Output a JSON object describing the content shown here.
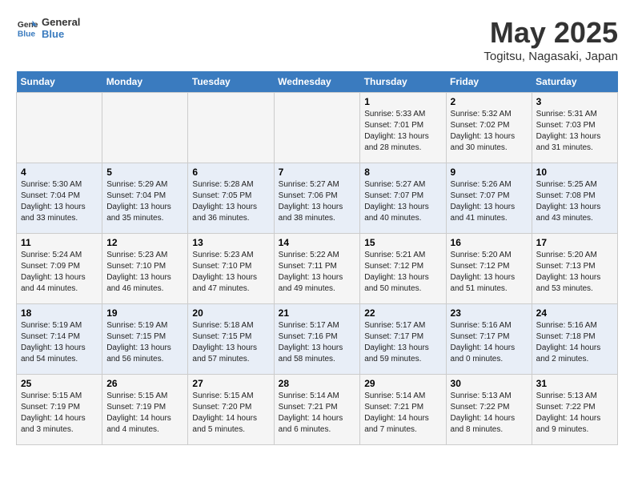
{
  "logo": {
    "line1": "General",
    "line2": "Blue"
  },
  "title": "May 2025",
  "subtitle": "Togitsu, Nagasaki, Japan",
  "days_of_week": [
    "Sunday",
    "Monday",
    "Tuesday",
    "Wednesday",
    "Thursday",
    "Friday",
    "Saturday"
  ],
  "weeks": [
    [
      {
        "day": "",
        "detail": ""
      },
      {
        "day": "",
        "detail": ""
      },
      {
        "day": "",
        "detail": ""
      },
      {
        "day": "",
        "detail": ""
      },
      {
        "day": "1",
        "detail": "Sunrise: 5:33 AM\nSunset: 7:01 PM\nDaylight: 13 hours\nand 28 minutes."
      },
      {
        "day": "2",
        "detail": "Sunrise: 5:32 AM\nSunset: 7:02 PM\nDaylight: 13 hours\nand 30 minutes."
      },
      {
        "day": "3",
        "detail": "Sunrise: 5:31 AM\nSunset: 7:03 PM\nDaylight: 13 hours\nand 31 minutes."
      }
    ],
    [
      {
        "day": "4",
        "detail": "Sunrise: 5:30 AM\nSunset: 7:04 PM\nDaylight: 13 hours\nand 33 minutes."
      },
      {
        "day": "5",
        "detail": "Sunrise: 5:29 AM\nSunset: 7:04 PM\nDaylight: 13 hours\nand 35 minutes."
      },
      {
        "day": "6",
        "detail": "Sunrise: 5:28 AM\nSunset: 7:05 PM\nDaylight: 13 hours\nand 36 minutes."
      },
      {
        "day": "7",
        "detail": "Sunrise: 5:27 AM\nSunset: 7:06 PM\nDaylight: 13 hours\nand 38 minutes."
      },
      {
        "day": "8",
        "detail": "Sunrise: 5:27 AM\nSunset: 7:07 PM\nDaylight: 13 hours\nand 40 minutes."
      },
      {
        "day": "9",
        "detail": "Sunrise: 5:26 AM\nSunset: 7:07 PM\nDaylight: 13 hours\nand 41 minutes."
      },
      {
        "day": "10",
        "detail": "Sunrise: 5:25 AM\nSunset: 7:08 PM\nDaylight: 13 hours\nand 43 minutes."
      }
    ],
    [
      {
        "day": "11",
        "detail": "Sunrise: 5:24 AM\nSunset: 7:09 PM\nDaylight: 13 hours\nand 44 minutes."
      },
      {
        "day": "12",
        "detail": "Sunrise: 5:23 AM\nSunset: 7:10 PM\nDaylight: 13 hours\nand 46 minutes."
      },
      {
        "day": "13",
        "detail": "Sunrise: 5:23 AM\nSunset: 7:10 PM\nDaylight: 13 hours\nand 47 minutes."
      },
      {
        "day": "14",
        "detail": "Sunrise: 5:22 AM\nSunset: 7:11 PM\nDaylight: 13 hours\nand 49 minutes."
      },
      {
        "day": "15",
        "detail": "Sunrise: 5:21 AM\nSunset: 7:12 PM\nDaylight: 13 hours\nand 50 minutes."
      },
      {
        "day": "16",
        "detail": "Sunrise: 5:20 AM\nSunset: 7:12 PM\nDaylight: 13 hours\nand 51 minutes."
      },
      {
        "day": "17",
        "detail": "Sunrise: 5:20 AM\nSunset: 7:13 PM\nDaylight: 13 hours\nand 53 minutes."
      }
    ],
    [
      {
        "day": "18",
        "detail": "Sunrise: 5:19 AM\nSunset: 7:14 PM\nDaylight: 13 hours\nand 54 minutes."
      },
      {
        "day": "19",
        "detail": "Sunrise: 5:19 AM\nSunset: 7:15 PM\nDaylight: 13 hours\nand 56 minutes."
      },
      {
        "day": "20",
        "detail": "Sunrise: 5:18 AM\nSunset: 7:15 PM\nDaylight: 13 hours\nand 57 minutes."
      },
      {
        "day": "21",
        "detail": "Sunrise: 5:17 AM\nSunset: 7:16 PM\nDaylight: 13 hours\nand 58 minutes."
      },
      {
        "day": "22",
        "detail": "Sunrise: 5:17 AM\nSunset: 7:17 PM\nDaylight: 13 hours\nand 59 minutes."
      },
      {
        "day": "23",
        "detail": "Sunrise: 5:16 AM\nSunset: 7:17 PM\nDaylight: 14 hours\nand 0 minutes."
      },
      {
        "day": "24",
        "detail": "Sunrise: 5:16 AM\nSunset: 7:18 PM\nDaylight: 14 hours\nand 2 minutes."
      }
    ],
    [
      {
        "day": "25",
        "detail": "Sunrise: 5:15 AM\nSunset: 7:19 PM\nDaylight: 14 hours\nand 3 minutes."
      },
      {
        "day": "26",
        "detail": "Sunrise: 5:15 AM\nSunset: 7:19 PM\nDaylight: 14 hours\nand 4 minutes."
      },
      {
        "day": "27",
        "detail": "Sunrise: 5:15 AM\nSunset: 7:20 PM\nDaylight: 14 hours\nand 5 minutes."
      },
      {
        "day": "28",
        "detail": "Sunrise: 5:14 AM\nSunset: 7:21 PM\nDaylight: 14 hours\nand 6 minutes."
      },
      {
        "day": "29",
        "detail": "Sunrise: 5:14 AM\nSunset: 7:21 PM\nDaylight: 14 hours\nand 7 minutes."
      },
      {
        "day": "30",
        "detail": "Sunrise: 5:13 AM\nSunset: 7:22 PM\nDaylight: 14 hours\nand 8 minutes."
      },
      {
        "day": "31",
        "detail": "Sunrise: 5:13 AM\nSunset: 7:22 PM\nDaylight: 14 hours\nand 9 minutes."
      }
    ]
  ]
}
